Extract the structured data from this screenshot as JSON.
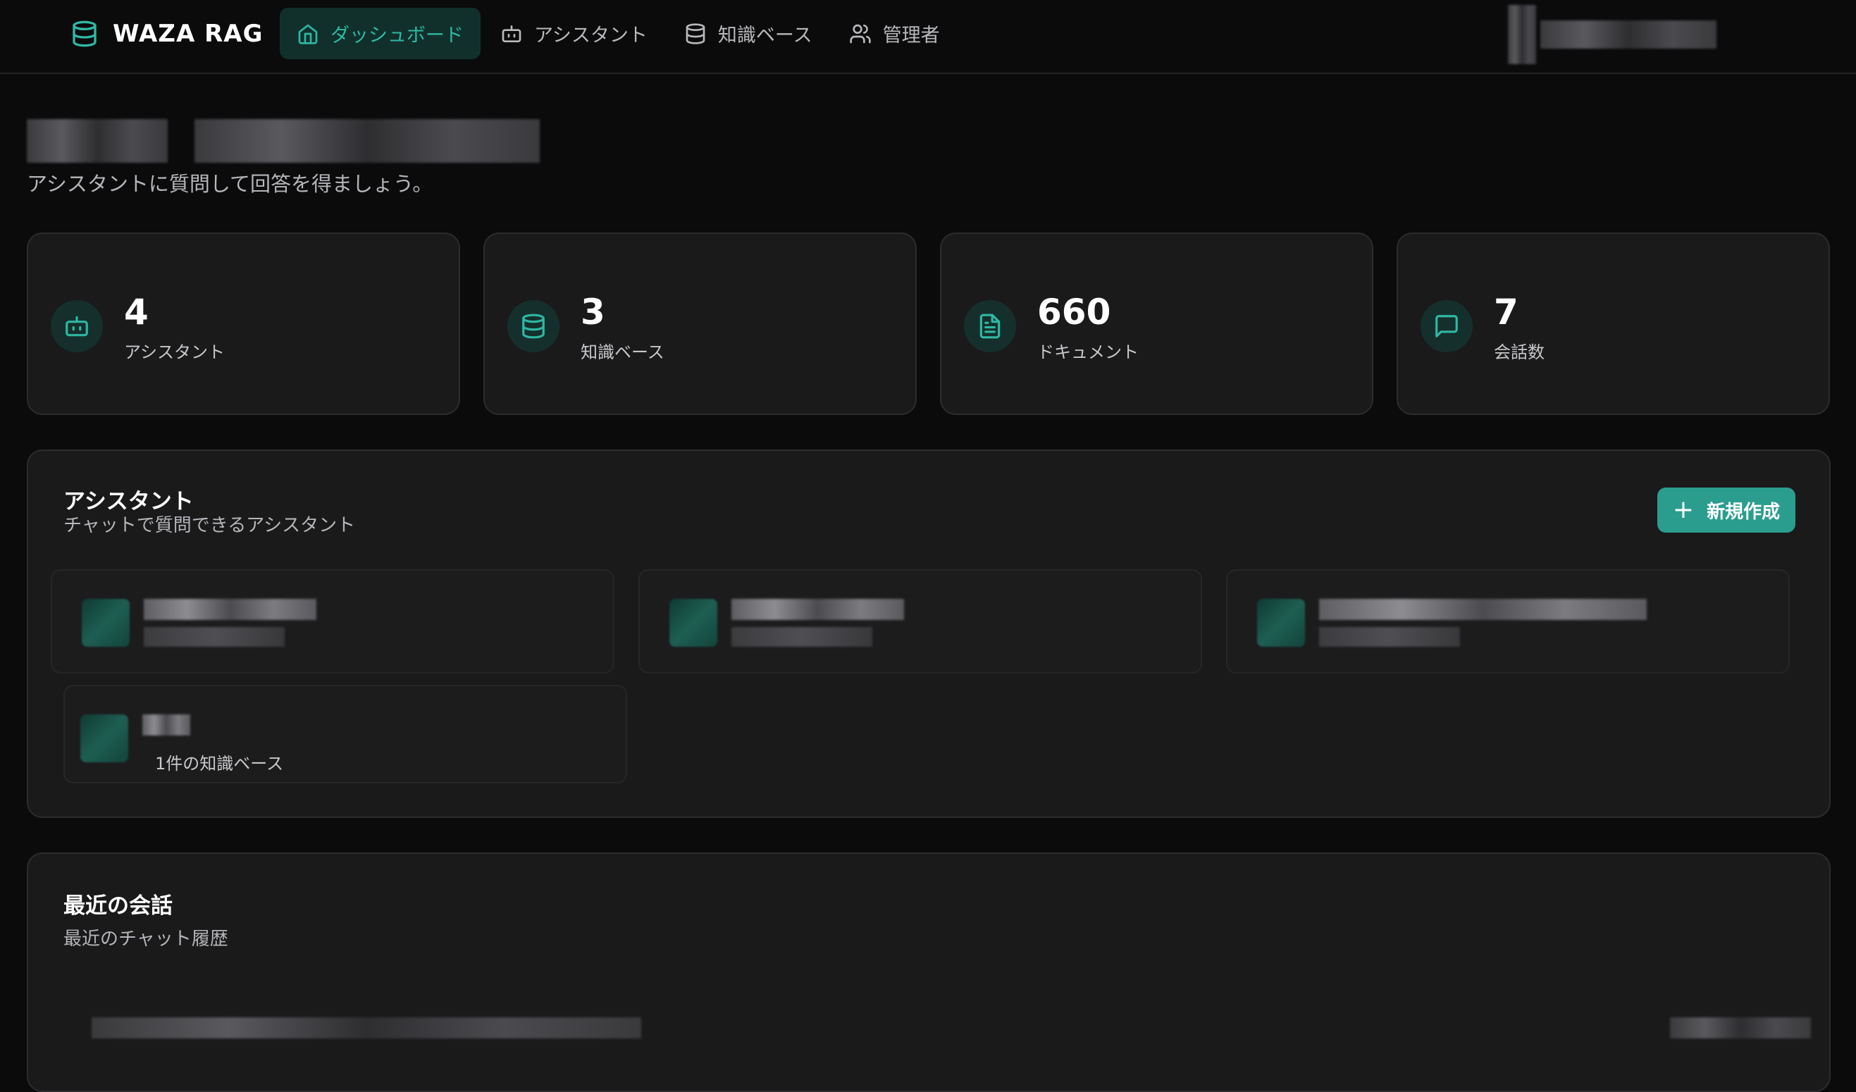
{
  "app": {
    "name": "WAZA RAG",
    "accent_color": "#2a9d8f"
  },
  "nav": {
    "items": [
      {
        "label": "ダッシュボード",
        "icon": "home-icon",
        "active": true
      },
      {
        "label": "アシスタント",
        "icon": "bot-icon",
        "active": false
      },
      {
        "label": "知識ベース",
        "icon": "database-icon",
        "active": false
      },
      {
        "label": "管理者",
        "icon": "users-icon",
        "active": false
      }
    ]
  },
  "header": {
    "subtitle": "アシスタントに質問して回答を得ましょう。"
  },
  "stats": [
    {
      "value": "4",
      "label": "アシスタント",
      "icon": "bot-icon"
    },
    {
      "value": "3",
      "label": "知識ベース",
      "icon": "database-icon"
    },
    {
      "value": "660",
      "label": "ドキュメント",
      "icon": "document-icon"
    },
    {
      "value": "7",
      "label": "会話数",
      "icon": "chat-icon"
    }
  ],
  "assistants_panel": {
    "title": "アシスタント",
    "description": "チャットで質問できるアシスタント",
    "new_button": "新規作成",
    "fourth_card_meta": "1件の知識ベース"
  },
  "recent_panel": {
    "title": "最近の会話",
    "description": "最近のチャット履歴"
  }
}
